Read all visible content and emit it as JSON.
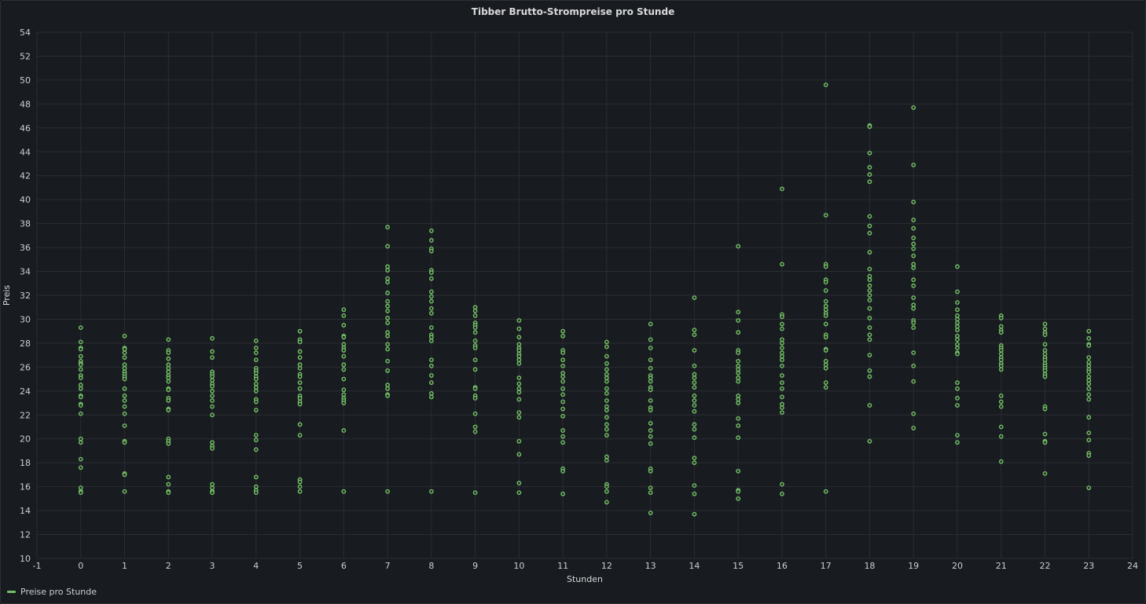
{
  "panel": {
    "title": "Tibber Brutto-Strompreise pro Stunde"
  },
  "colors": {
    "background": "#181b1f",
    "grid": "#2a2d33",
    "series": "#73bf69",
    "text": "#c7d0d9"
  },
  "chart_data": {
    "type": "scatter",
    "title": "Tibber Brutto-Strompreise pro Stunde",
    "xlabel": "Stunden",
    "ylabel": "Preis",
    "xlim": [
      -1,
      24
    ],
    "ylim": [
      10,
      54
    ],
    "xticks": [
      -1,
      0,
      1,
      2,
      3,
      4,
      5,
      6,
      7,
      8,
      9,
      10,
      11,
      12,
      13,
      14,
      15,
      16,
      17,
      18,
      19,
      20,
      21,
      22,
      23,
      24
    ],
    "yticks": [
      10,
      12,
      14,
      16,
      18,
      20,
      22,
      24,
      26,
      28,
      30,
      32,
      34,
      36,
      38,
      40,
      42,
      44,
      46,
      48,
      50,
      52,
      54
    ],
    "grid": true,
    "legend_position": "bottom-left",
    "series": [
      {
        "name": "Preise pro Stunde",
        "points_by_hour": {
          "0": [
            29.3,
            28.1,
            27.6,
            27.5,
            26.9,
            26.5,
            26.3,
            26.2,
            25.8,
            25.3,
            25.1,
            24.5,
            24.2,
            23.6,
            23.5,
            22.9,
            22.8,
            22.1,
            20.0,
            19.7,
            18.3,
            17.6,
            15.9,
            15.6,
            15.5
          ],
          "1": [
            28.6,
            27.6,
            27.5,
            27.2,
            26.8,
            26.2,
            25.9,
            25.6,
            25.4,
            25.2,
            25.0,
            24.2,
            23.6,
            23.2,
            22.7,
            22.1,
            21.1,
            19.8,
            19.7,
            17.1,
            17.0,
            15.6
          ],
          "2": [
            28.3,
            27.4,
            27.2,
            26.7,
            26.2,
            25.9,
            25.6,
            25.3,
            25.1,
            24.8,
            24.2,
            24.1,
            23.4,
            23.2,
            22.5,
            22.4,
            20.0,
            19.8,
            19.6,
            16.8,
            16.2,
            15.6,
            15.5
          ],
          "3": [
            28.4,
            27.3,
            26.8,
            25.6,
            25.4,
            25.2,
            24.9,
            24.6,
            24.4,
            24.0,
            23.6,
            23.2,
            22.7,
            22.0,
            19.7,
            19.4,
            19.2,
            16.2,
            15.9,
            15.6,
            15.5
          ],
          "4": [
            28.2,
            27.6,
            27.2,
            26.6,
            25.9,
            25.7,
            25.5,
            25.2,
            25.0,
            24.6,
            24.3,
            24.0,
            23.3,
            23.1,
            22.4,
            20.3,
            19.9,
            19.1,
            16.8,
            16.0,
            15.7,
            15.5
          ],
          "5": [
            29.0,
            28.3,
            28.1,
            27.3,
            26.8,
            26.2,
            25.9,
            25.4,
            25.2,
            24.7,
            24.2,
            23.6,
            23.4,
            23.1,
            22.9,
            21.2,
            20.3,
            16.6,
            16.4,
            16.0,
            15.6
          ],
          "6": [
            30.8,
            30.3,
            29.5,
            28.6,
            28.5,
            27.9,
            27.6,
            27.4,
            26.9,
            26.2,
            25.8,
            25.0,
            24.1,
            23.7,
            23.4,
            23.2,
            23.0,
            20.7,
            15.6
          ],
          "7": [
            37.7,
            36.1,
            34.4,
            34.1,
            33.4,
            33.1,
            32.2,
            31.5,
            31.1,
            30.7,
            30.1,
            29.7,
            28.9,
            28.6,
            27.9,
            27.5,
            26.5,
            25.7,
            24.5,
            24.2,
            23.7,
            23.6,
            15.6
          ],
          "8": [
            37.4,
            36.6,
            35.9,
            35.7,
            34.1,
            33.9,
            33.4,
            32.3,
            31.9,
            31.5,
            30.9,
            30.5,
            29.3,
            28.7,
            28.5,
            28.2,
            26.6,
            26.1,
            25.3,
            24.7,
            23.8,
            23.5,
            15.6
          ],
          "9": [
            31.0,
            30.7,
            30.3,
            29.7,
            29.5,
            29.3,
            28.9,
            28.2,
            27.8,
            27.6,
            26.6,
            25.8,
            24.3,
            24.2,
            23.6,
            23.4,
            22.1,
            21.0,
            20.6,
            15.5
          ],
          "10": [
            29.9,
            29.2,
            28.5,
            27.9,
            27.6,
            27.4,
            27.1,
            26.9,
            26.6,
            26.3,
            25.1,
            24.6,
            24.2,
            23.9,
            23.3,
            22.2,
            21.8,
            19.8,
            18.7,
            16.3,
            15.5
          ],
          "11": [
            29.0,
            28.6,
            27.4,
            27.2,
            26.6,
            26.1,
            25.5,
            25.2,
            24.8,
            24.2,
            23.7,
            23.1,
            22.5,
            21.9,
            20.7,
            20.2,
            19.7,
            17.5,
            17.3,
            15.4
          ],
          "12": [
            28.1,
            27.7,
            26.9,
            26.3,
            25.8,
            25.4,
            25.1,
            24.8,
            24.2,
            23.8,
            23.2,
            22.7,
            22.4,
            21.8,
            21.2,
            20.8,
            20.3,
            18.5,
            18.2,
            16.2,
            16.0,
            15.6,
            14.7
          ],
          "13": [
            29.6,
            28.3,
            27.6,
            26.6,
            25.9,
            25.3,
            25.1,
            24.8,
            24.3,
            24.1,
            23.2,
            22.6,
            22.4,
            21.3,
            20.7,
            20.2,
            19.6,
            17.5,
            17.3,
            15.9,
            15.5,
            13.8
          ],
          "14": [
            31.8,
            29.1,
            28.7,
            27.4,
            26.1,
            25.4,
            25.1,
            24.7,
            24.3,
            23.6,
            23.2,
            22.8,
            22.3,
            21.2,
            20.8,
            20.1,
            18.4,
            18.0,
            16.1,
            15.4,
            13.7
          ],
          "15": [
            36.1,
            30.6,
            29.9,
            28.9,
            27.4,
            27.2,
            26.5,
            26.1,
            25.8,
            25.5,
            25.1,
            24.8,
            23.6,
            23.3,
            23.0,
            21.7,
            21.1,
            20.1,
            17.3,
            15.7,
            15.6,
            15.0
          ],
          "16": [
            40.9,
            34.6,
            30.4,
            30.2,
            29.6,
            29.2,
            28.3,
            28.0,
            27.6,
            27.2,
            26.9,
            26.6,
            26.1,
            25.3,
            24.7,
            24.2,
            23.5,
            22.9,
            22.6,
            22.2,
            16.2,
            15.4
          ],
          "17": [
            49.6,
            38.7,
            34.6,
            34.4,
            33.3,
            33.1,
            32.4,
            31.5,
            31.1,
            30.8,
            30.5,
            30.3,
            29.6,
            28.7,
            28.5,
            27.5,
            27.4,
            26.5,
            26.2,
            25.9,
            24.7,
            24.3,
            15.6
          ],
          "18": [
            46.2,
            46.1,
            43.9,
            42.7,
            42.1,
            41.5,
            38.6,
            37.8,
            37.2,
            35.6,
            34.2,
            33.6,
            33.3,
            32.8,
            32.4,
            32.0,
            31.6,
            30.9,
            30.1,
            29.3,
            28.7,
            28.3,
            27.0,
            25.7,
            25.2,
            22.8,
            19.8
          ],
          "19": [
            47.7,
            42.9,
            39.8,
            38.3,
            37.6,
            36.8,
            36.3,
            35.9,
            35.3,
            34.6,
            34.3,
            33.3,
            32.8,
            31.8,
            31.2,
            30.9,
            29.9,
            29.7,
            29.3,
            27.2,
            26.1,
            24.8,
            22.1,
            20.9
          ],
          "20": [
            34.4,
            32.3,
            31.4,
            30.8,
            30.3,
            30.0,
            29.7,
            29.4,
            29.1,
            28.6,
            28.3,
            27.9,
            27.6,
            27.2,
            27.1,
            24.7,
            24.2,
            23.4,
            22.8,
            20.3,
            19.7
          ],
          "21": [
            30.3,
            30.1,
            29.4,
            29.1,
            28.9,
            27.8,
            27.6,
            27.4,
            27.1,
            26.8,
            26.6,
            26.3,
            26.1,
            25.8,
            23.6,
            23.1,
            22.7,
            21.0,
            20.2,
            18.1
          ],
          "22": [
            29.6,
            29.2,
            28.9,
            28.7,
            27.9,
            27.4,
            27.1,
            26.8,
            26.6,
            26.3,
            26.1,
            25.9,
            25.7,
            25.4,
            25.2,
            22.7,
            22.5,
            20.4,
            19.8,
            19.7,
            17.1
          ],
          "23": [
            29.0,
            28.4,
            27.9,
            27.8,
            26.8,
            26.4,
            26.1,
            25.8,
            25.6,
            25.2,
            24.9,
            24.6,
            24.2,
            23.7,
            23.3,
            21.8,
            20.5,
            19.9,
            18.8,
            18.6,
            15.9
          ]
        }
      }
    ]
  }
}
